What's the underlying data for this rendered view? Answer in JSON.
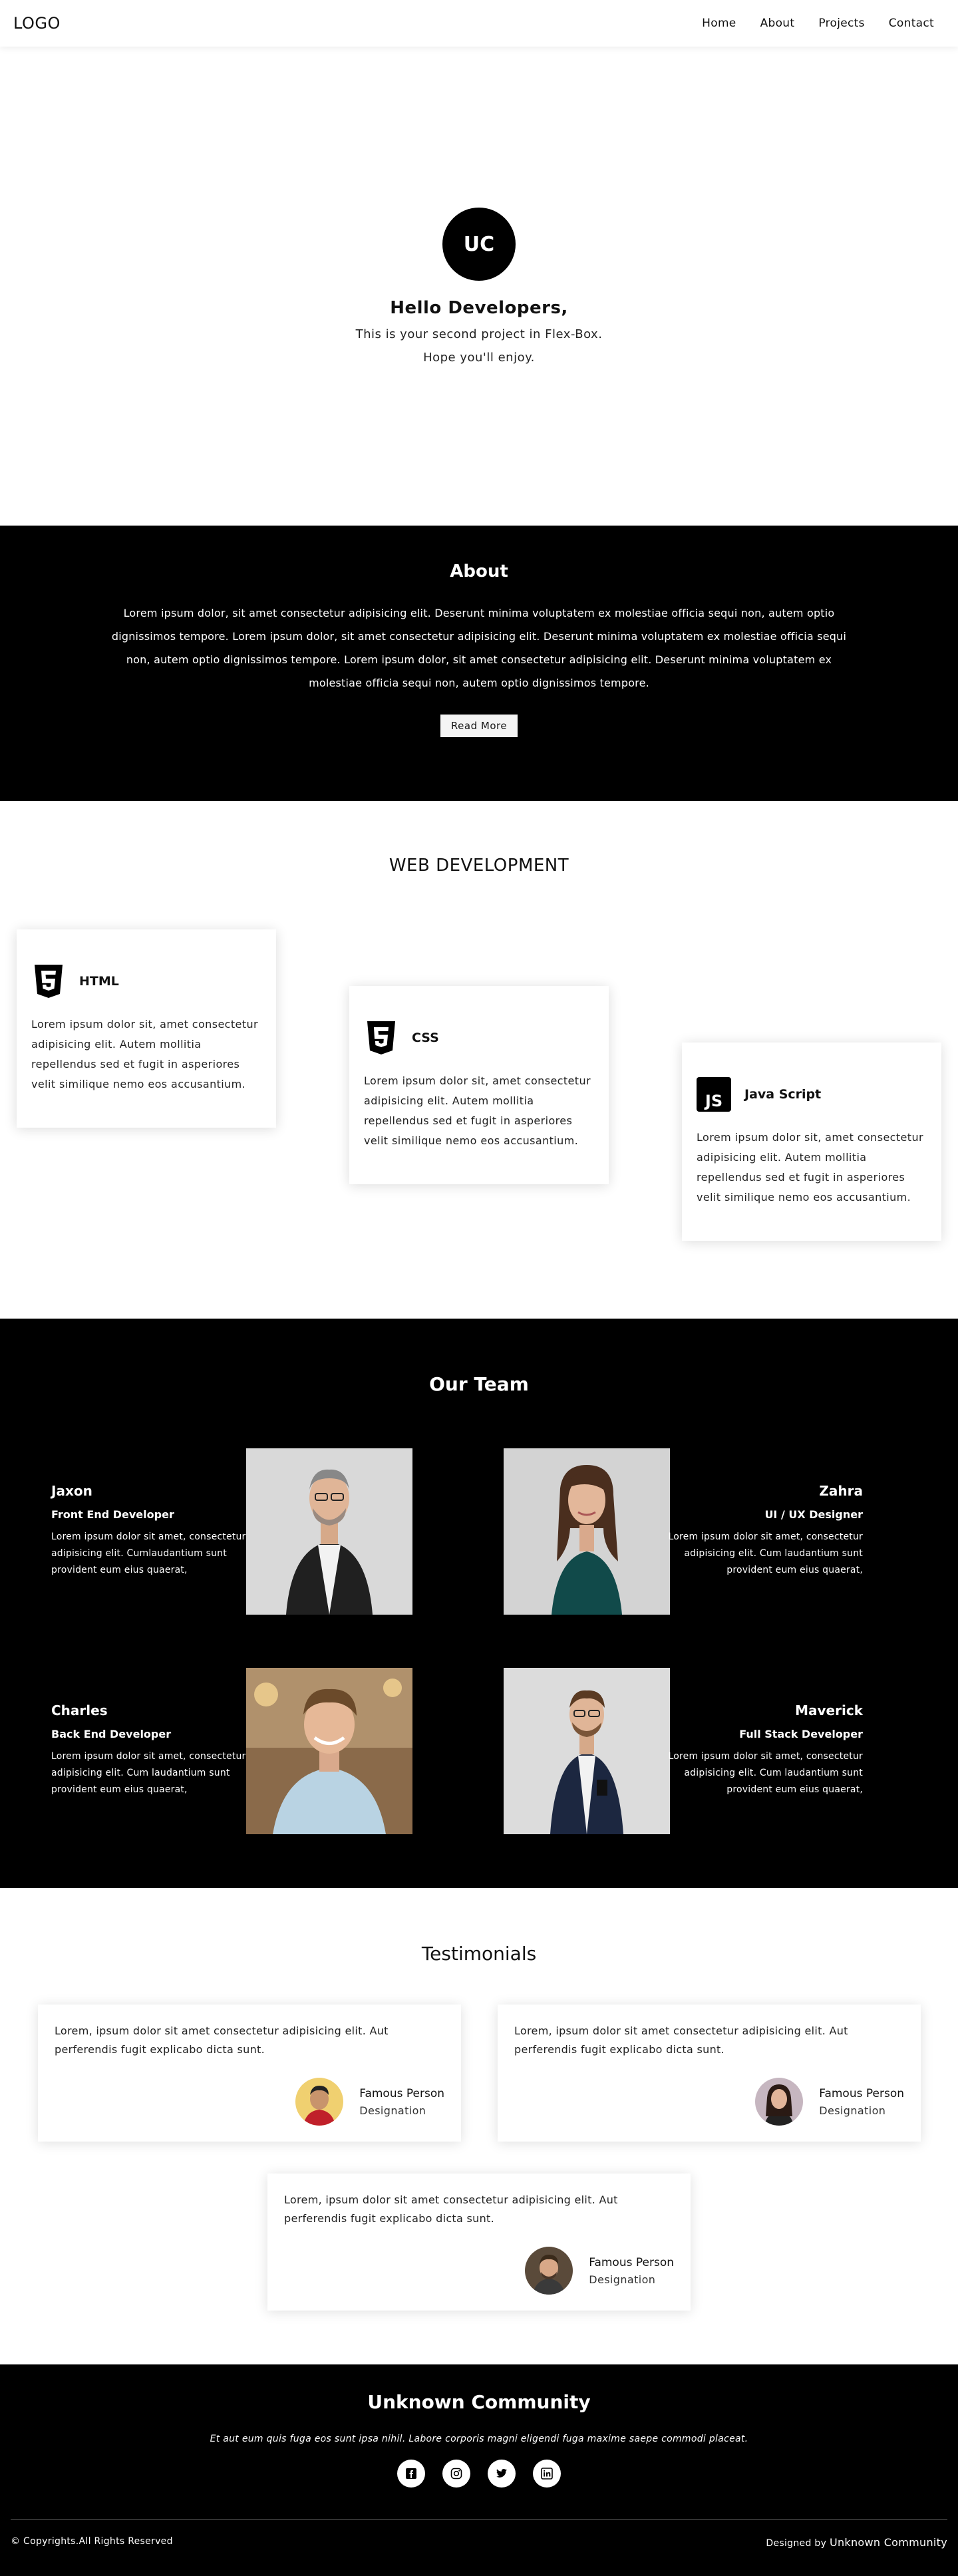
{
  "nav": {
    "logo": "LOGO",
    "links": [
      "Home",
      "About",
      "Projects",
      "Contact"
    ]
  },
  "hero": {
    "initials": "UC",
    "title": "Hello Developers,",
    "line1": "This is your second project in Flex-Box.",
    "line2": "Hope you'll enjoy."
  },
  "about": {
    "title": "About",
    "text": "Lorem ipsum dolor, sit amet consectetur adipisicing elit. Deserunt minima voluptatem ex molestiae officia sequi non, autem optio dignissimos tempore. Lorem ipsum dolor, sit amet consectetur adipisicing elit. Deserunt minima voluptatem ex molestiae officia sequi non, autem optio dignissimos tempore. Lorem ipsum dolor, sit amet consectetur adipisicing elit. Deserunt minima voluptatem ex molestiae officia sequi non, autem optio dignissimos tempore.",
    "button": "Read More"
  },
  "webdev": {
    "title": "WEB DEVELOPMENT",
    "cards": [
      {
        "title": "HTML",
        "icon": "html5-icon",
        "text": "Lorem ipsum dolor sit, amet consectetur adipisicing elit. Autem mollitia repellendus sed et fugit in asperiores velit similique nemo eos accusantium."
      },
      {
        "title": "CSS",
        "icon": "css3-icon",
        "text": "Lorem ipsum dolor sit, amet consectetur adipisicing elit. Autem mollitia repellendus sed et fugit in asperiores velit similique nemo eos accusantium."
      },
      {
        "title": "Java Script",
        "icon": "javascript-icon",
        "text": "Lorem ipsum dolor sit, amet consectetur adipisicing elit. Autem mollitia repellendus sed et fugit in asperiores velit similique nemo eos accusantium."
      }
    ]
  },
  "team": {
    "title": "Our Team",
    "members": [
      {
        "name": "Jaxon",
        "role": "Front End Developer",
        "bio": "Lorem ipsum dolor sit amet, consectetur adipisicing elit. Cumlaudantium sunt provident eum eius quaerat,"
      },
      {
        "name": "Zahra",
        "role": "UI / UX Designer",
        "bio": "Lorem ipsum dolor sit amet, consectetur adipisicing elit. Cum laudantium sunt provident eum eius quaerat,"
      },
      {
        "name": "Charles",
        "role": "Back End Developer",
        "bio": "Lorem ipsum dolor sit amet, consectetur adipisicing elit. Cum laudantium sunt provident eum eius quaerat,"
      },
      {
        "name": "Maverick",
        "role": "Full Stack Developer",
        "bio": "Lorem ipsum dolor sit amet, consectetur adipisicing elit. Cum laudantium sunt provident eum eius quaerat,"
      }
    ]
  },
  "testimonials": {
    "title": "Testimonials",
    "items": [
      {
        "text": "Lorem, ipsum dolor sit amet consectetur adipisicing elit. Aut perferendis fugit explicabo dicta sunt.",
        "name": "Famous Person",
        "designation": "Designation"
      },
      {
        "text": "Lorem, ipsum dolor sit amet consectetur adipisicing elit. Aut perferendis fugit explicabo dicta sunt.",
        "name": "Famous Person",
        "designation": "Designation"
      },
      {
        "text": "Lorem, ipsum dolor sit amet consectetur adipisicing elit. Aut perferendis fugit explicabo dicta sunt.",
        "name": "Famous Person",
        "designation": "Designation"
      }
    ]
  },
  "footer": {
    "title": "Unknown Community",
    "tagline": "Et aut eum quis fuga eos sunt ipsa nihil. Labore corporis magni eligendi fuga maxime saepe commodi placeat.",
    "socials": [
      "facebook-icon",
      "instagram-icon",
      "twitter-icon",
      "linkedin-icon"
    ],
    "copyright": "© Copyrights.All Rights Reserved",
    "designed_prefix": "Designed by",
    "designed_name": "Unknown Community"
  }
}
